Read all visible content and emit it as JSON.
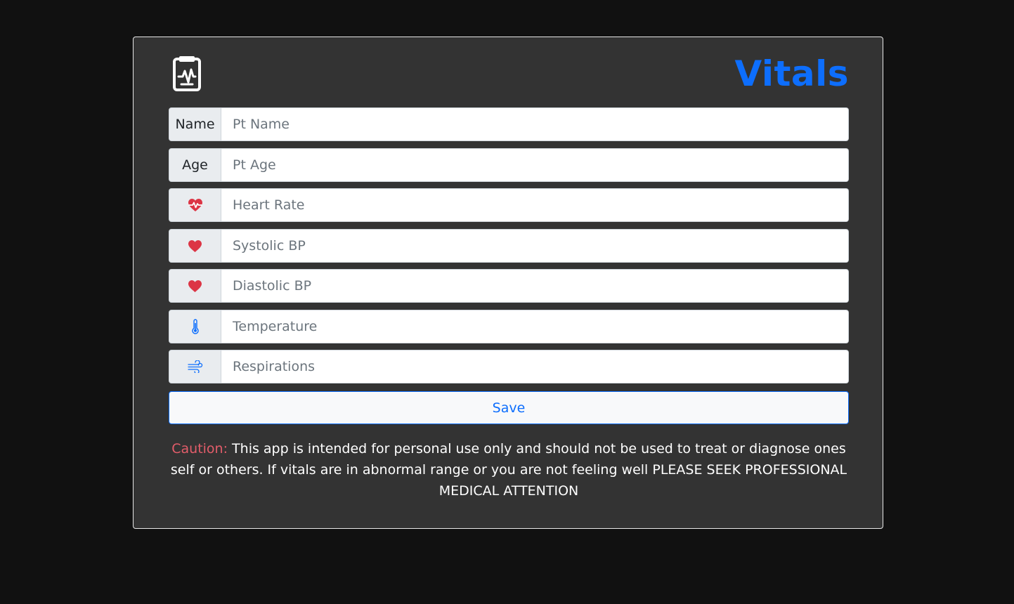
{
  "header": {
    "title": "Vitals",
    "logo_icon": "clipboard-pulse-icon"
  },
  "fields": [
    {
      "id": "name",
      "addon_text": "Name",
      "addon_icon": null,
      "placeholder": "Pt Name",
      "value": ""
    },
    {
      "id": "age",
      "addon_text": "Age",
      "addon_icon": null,
      "placeholder": "Pt Age",
      "value": ""
    },
    {
      "id": "heart-rate",
      "addon_text": null,
      "addon_icon": "heart-pulse-icon",
      "placeholder": "Heart Rate",
      "value": ""
    },
    {
      "id": "systolic-bp",
      "addon_text": null,
      "addon_icon": "heart-icon",
      "placeholder": "Systolic BP",
      "value": ""
    },
    {
      "id": "diastolic-bp",
      "addon_text": null,
      "addon_icon": "heart-icon",
      "placeholder": "Diastolic BP",
      "value": ""
    },
    {
      "id": "temperature",
      "addon_text": null,
      "addon_icon": "thermometer-icon",
      "placeholder": "Temperature",
      "value": ""
    },
    {
      "id": "respirations",
      "addon_text": null,
      "addon_icon": "wind-icon",
      "placeholder": "Respirations",
      "value": ""
    }
  ],
  "save_button": {
    "label": "Save"
  },
  "caution": {
    "label": "Caution:",
    "text": " This app is intended for personal use only and should not be used to treat or diagnose ones self or others. If vitals are in abnormal range or you are not feeling well PLEASE SEEK PROFESSIONAL MEDICAL ATTENTION"
  },
  "colors": {
    "page_background": "#111111",
    "card_background": "#333333",
    "accent": "#0d6efd",
    "heart": "#dc3545",
    "caution": "#e35d6a"
  }
}
